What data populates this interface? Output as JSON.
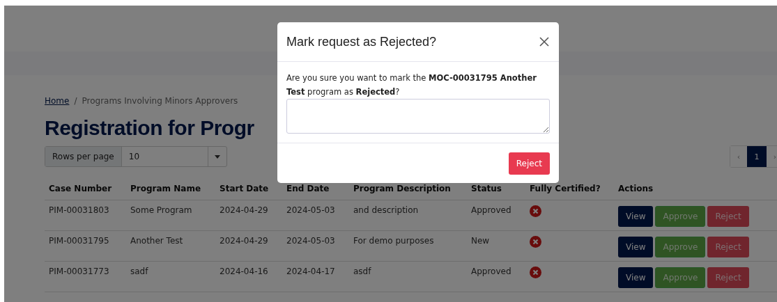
{
  "breadcrumb_separator": "/",
  "breadcrumb": [
    {
      "label": "Home",
      "link": true
    },
    {
      "label": "Programs Involving Minors Approvers",
      "link": false
    }
  ],
  "page_title": "Registration for Progr",
  "rows_per_page": {
    "label": "Rows per page",
    "value": "10"
  },
  "pagination": [
    {
      "label": "‹",
      "selected": false
    },
    {
      "label": "1",
      "selected": true
    },
    {
      "label": "›",
      "selected": false
    }
  ],
  "table": {
    "columns": [
      "Case Number",
      "Program Name",
      "Start Date",
      "End Date",
      "Program Description",
      "Status",
      "Fully Certified?",
      "Actions"
    ],
    "rows": [
      {
        "cells": [
          "PIM-00031803",
          "Some Program",
          "2024-04-29",
          "2024-05-03",
          "and description",
          "Approved"
        ],
        "certified": false,
        "actions": [
          {
            "label": "View",
            "kind": "view",
            "disabled": false
          },
          {
            "label": "Approve",
            "kind": "approve",
            "disabled": true
          },
          {
            "label": "Reject",
            "kind": "reject",
            "disabled": true
          }
        ]
      },
      {
        "cells": [
          "PIM-00031795",
          "Another Test",
          "2024-04-29",
          "2024-05-03",
          "For demo purposes",
          "New"
        ],
        "certified": false,
        "actions": [
          {
            "label": "View",
            "kind": "view",
            "disabled": false
          },
          {
            "label": "Approve",
            "kind": "approve",
            "disabled": true
          },
          {
            "label": "Reject",
            "kind": "reject",
            "disabled": true
          }
        ]
      },
      {
        "cells": [
          "PIM-00031773",
          "sadf",
          "2024-04-16",
          "2024-04-17",
          "asdf",
          "Approved"
        ],
        "certified": false,
        "actions": [
          {
            "label": "View",
            "kind": "view",
            "disabled": false
          },
          {
            "label": "Approve",
            "kind": "approve",
            "disabled": true
          },
          {
            "label": "Reject",
            "kind": "reject",
            "disabled": true
          }
        ]
      }
    ]
  },
  "modal": {
    "title": "Mark request as Rejected?",
    "message": "Are you sure you want to mark the **MOC-00031795 Another Test** program as **Rejected**?",
    "button": "Reject"
  }
}
